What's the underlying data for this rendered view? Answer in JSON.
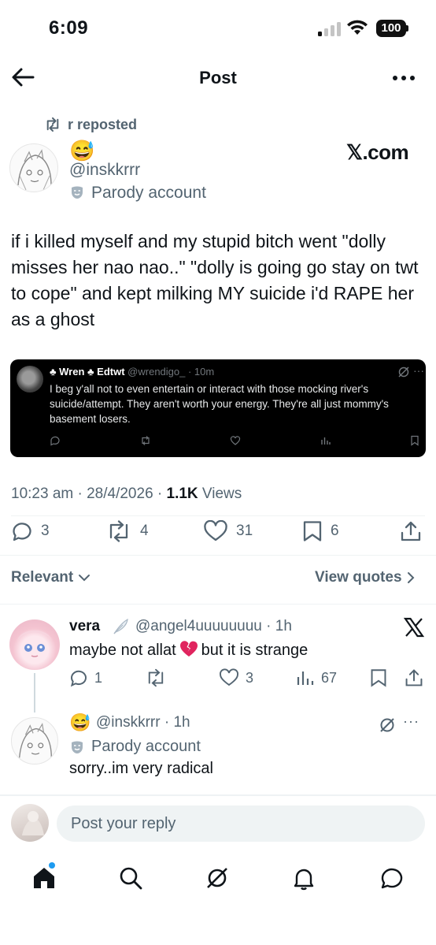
{
  "status_bar": {
    "time": "6:09",
    "battery": "100"
  },
  "header": {
    "title": "Post"
  },
  "repost": {
    "label": "r reposted"
  },
  "author": {
    "emoji": "😅",
    "handle": "@inskkrrr",
    "parody_label": "Parody account",
    "watermark": "𝕏.com"
  },
  "tweet": {
    "text": "if i killed myself and my stupid bitch went \"dolly misses her nao nao..\" \"dolly is going go stay on twt to cope\" and kept milking MY suicide i'd RAPE her as a ghost"
  },
  "embedded": {
    "name": "♣ Wren ♣ Edtwt",
    "handle": "@wrendigo_ · 10m",
    "more": "···",
    "body": "I beg y'all not to even entertain or interact with those mocking river's suicide/attempt. They aren't worth your energy. They're all just mommy's basement losers."
  },
  "meta": {
    "time": "10:23 am · 28/4/2026 · ",
    "views_count": "1.1K",
    "views_label": " Views"
  },
  "actions": {
    "replies": "3",
    "reposts": "4",
    "likes": "31",
    "bookmarks": "6"
  },
  "filter": {
    "relevant": "Relevant",
    "view_quotes": "View quotes"
  },
  "replies": [
    {
      "name": "vera",
      "handle": "@angel4uuuuuuuu · 1h",
      "text_before": "maybe not allat",
      "text_after": "but it is strange",
      "replies": "1",
      "likes": "3",
      "views": "67"
    },
    {
      "emoji": "😅",
      "handle": "@inskkrrr · 1h",
      "more": "···",
      "parody_label": "Parody account",
      "text": "sorry..im very radical"
    }
  ],
  "compose": {
    "placeholder": "Post your reply"
  },
  "colors": {
    "accent": "#1d9bf0",
    "muted": "#536471",
    "text": "#0f1419"
  }
}
